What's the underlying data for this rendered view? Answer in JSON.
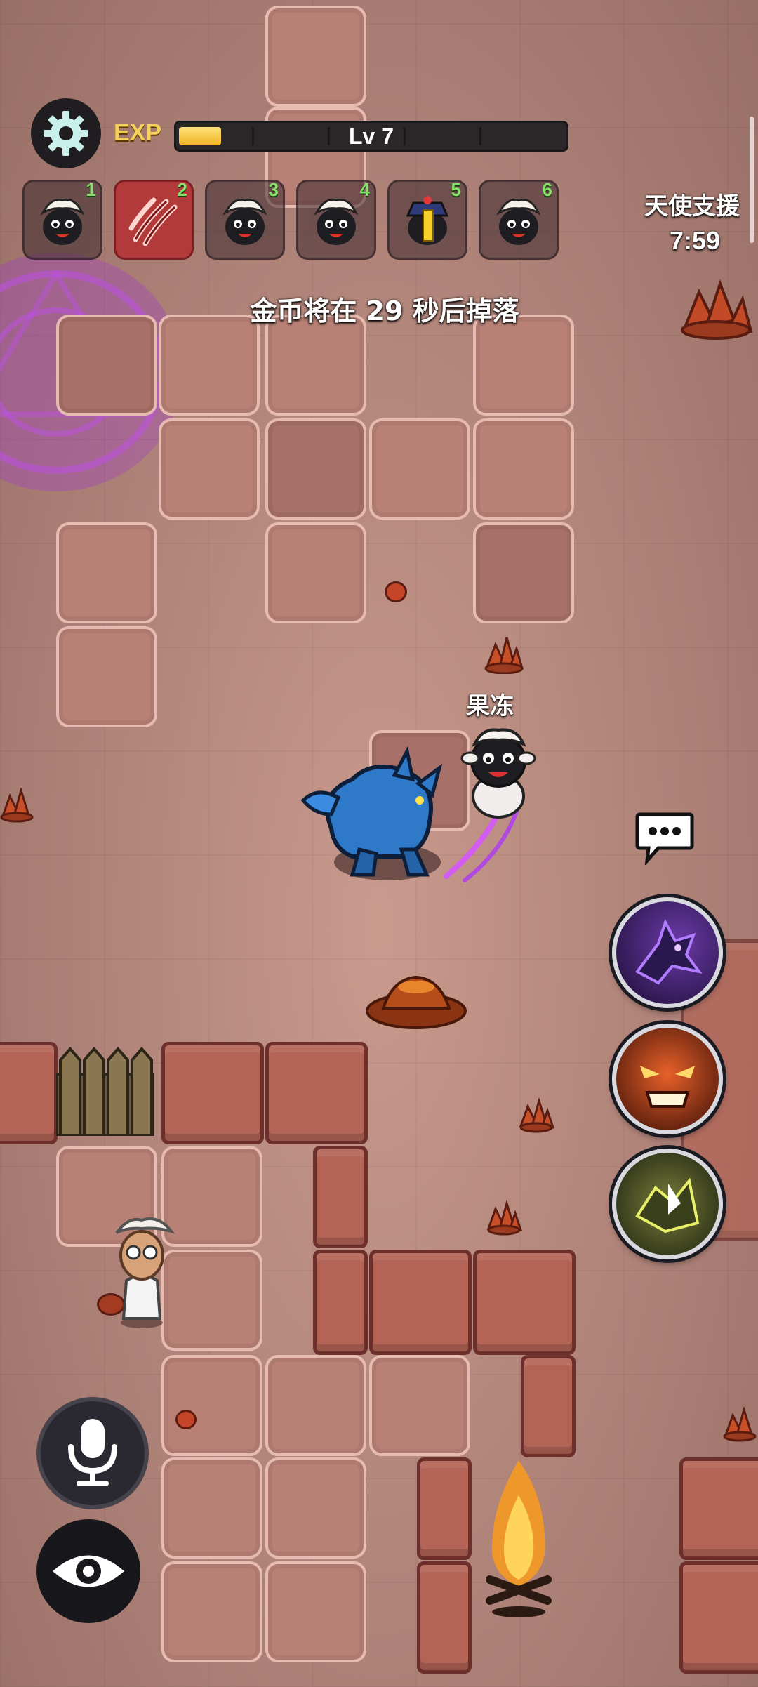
{
  "hud": {
    "exp_label": "EXP",
    "level_label": "Lv 7",
    "exp_progress": 0.11,
    "settings_icon": "gear-icon"
  },
  "character_slots": [
    {
      "number": "1",
      "icon": "sheep-icon",
      "active": false
    },
    {
      "number": "2",
      "icon": "claw-slash-icon",
      "active": true
    },
    {
      "number": "3",
      "icon": "sheep-icon",
      "active": false
    },
    {
      "number": "4",
      "icon": "sheep-icon",
      "active": false
    },
    {
      "number": "5",
      "icon": "jiangshi-sheep-icon",
      "active": false
    },
    {
      "number": "6",
      "icon": "sheep-icon",
      "active": false
    }
  ],
  "angel_support": {
    "title": "天使支援",
    "timer": "7:59"
  },
  "coin_notice": "金币将在 29 秒后掉落",
  "player": {
    "name": "果冻"
  },
  "buttons": {
    "chat": "chat-bubble-icon",
    "skills": [
      "wolf-howl-skill-icon",
      "rage-face-skill-icon",
      "lightning-beast-skill-icon"
    ],
    "mic": "microphone-icon",
    "eye": "eye-icon"
  },
  "colors": {
    "exp_fill": "#f0b324",
    "active_slot": "#b33a3a",
    "slot_number": "#86e06a"
  }
}
